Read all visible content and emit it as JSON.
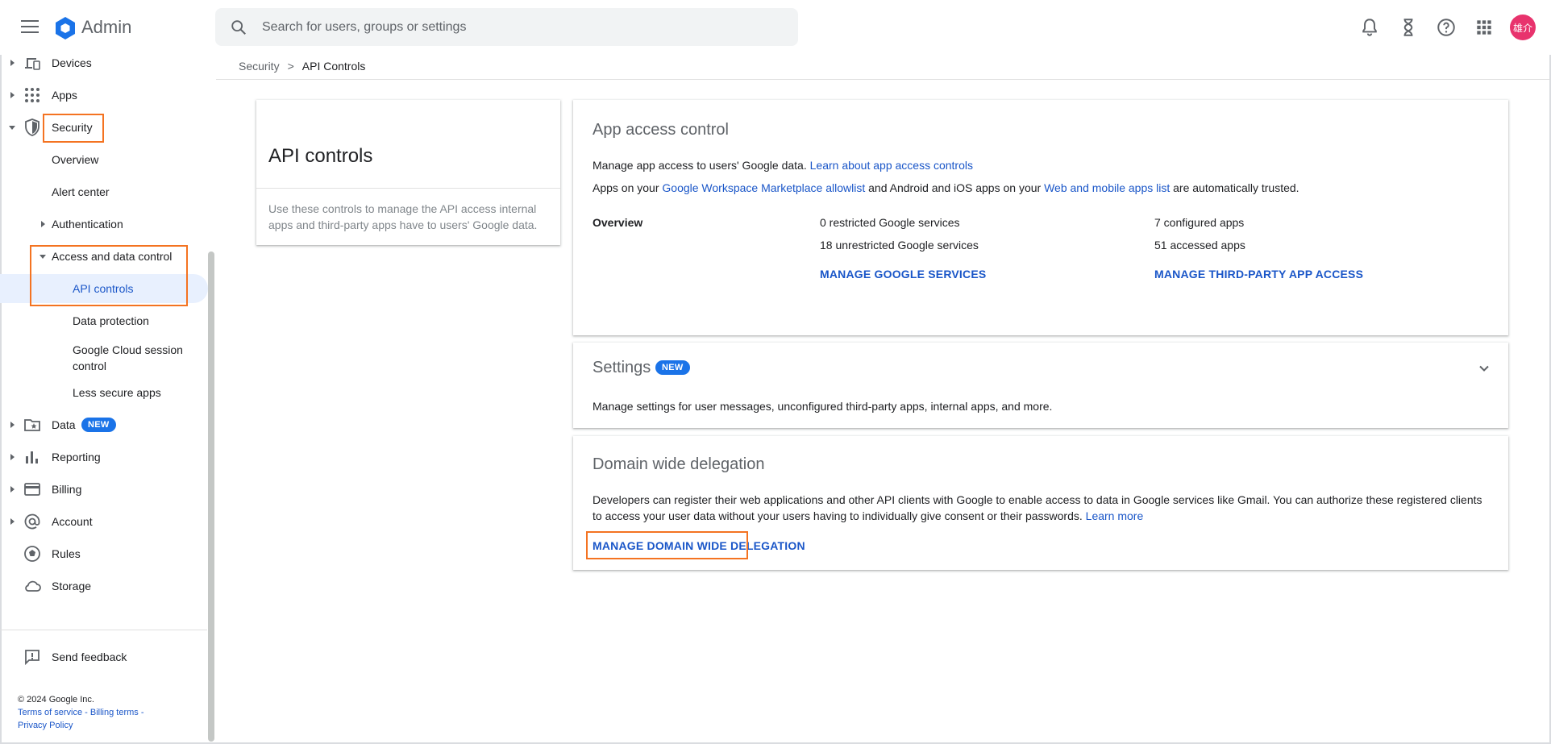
{
  "app": {
    "title": "Admin",
    "search_placeholder": "Search for users, groups or settings",
    "avatar_initials": "雄介",
    "accent_color": "#1a73e8",
    "avatar_color": "#e8336d",
    "highlight_color": "#f47321"
  },
  "topbar_icons": [
    "bell-icon",
    "hourglass-icon",
    "help-icon",
    "apps-grid-icon"
  ],
  "sidebar": {
    "devices": "Devices",
    "apps": "Apps",
    "security": "Security",
    "overview": "Overview",
    "alert_center": "Alert center",
    "authentication": "Authentication",
    "access_data_control": "Access and data control",
    "api_controls": "API controls",
    "data_protection": "Data protection",
    "gcloud_session_line1": "Google Cloud session",
    "gcloud_session_line2": "control",
    "less_secure_apps": "Less secure apps",
    "data": "Data",
    "data_badge": "NEW",
    "reporting": "Reporting",
    "billing": "Billing",
    "account": "Account",
    "rules": "Rules",
    "storage": "Storage",
    "send_feedback": "Send feedback",
    "copyright": "© 2024 Google Inc.",
    "terms": "Terms of service",
    "billing_terms": "Billing terms",
    "privacy": "Privacy Policy",
    "link_sep": "-"
  },
  "breadcrumb": {
    "parent": "Security",
    "separator": ">",
    "current": "API Controls"
  },
  "left_card": {
    "title": "API controls",
    "description": "Use these controls to manage the API access internal apps and third-party apps have to users' Google data."
  },
  "app_access": {
    "title": "App access control",
    "line1_text": "Manage app access to users' Google data.",
    "line1_link": "Learn about app access controls",
    "line2_a": "Apps on your",
    "line2_link1": "Google Workspace Marketplace allowlist",
    "line2_b": "and Android and iOS apps on your",
    "line2_link2": "Web and mobile apps list",
    "line2_c": "are automatically trusted.",
    "overview_label": "Overview",
    "restricted": "0 restricted Google services",
    "unrestricted": "18 unrestricted Google services",
    "configured": "7 configured apps",
    "accessed": "51 accessed apps",
    "manage_services": "MANAGE GOOGLE SERVICES",
    "manage_third_party": "MANAGE THIRD-PARTY APP ACCESS"
  },
  "settings": {
    "title": "Settings",
    "badge": "NEW",
    "description": "Manage settings for user messages, unconfigured third-party apps, internal apps, and more."
  },
  "delegation": {
    "title": "Domain wide delegation",
    "line1": "Developers can register their web applications and other API clients with Google to enable access to data in Google services like Gmail. You can authorize these registered clients",
    "line2": "to access your user data without your users having to individually give consent or their passwords.",
    "learn_more": "Learn more",
    "manage": "MANAGE DOMAIN WIDE DELEGATION"
  }
}
